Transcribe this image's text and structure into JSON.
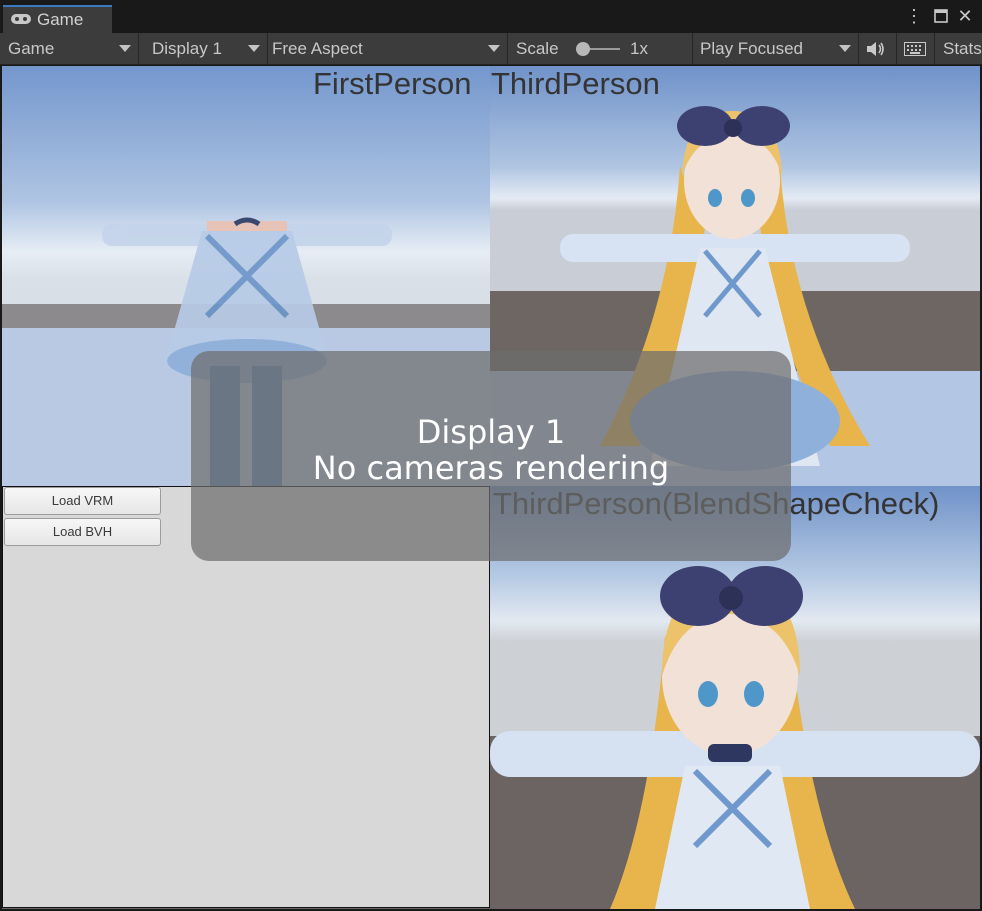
{
  "tab": {
    "title": "Game",
    "icon": "gamepad-icon"
  },
  "window_buttons": {
    "menu_icon": "kebab-menu-icon",
    "maximize_icon": "maximize-icon",
    "close_icon": "close-icon",
    "menu_glyph": "⋮",
    "close_glyph": "✕"
  },
  "toolbar": {
    "view_mode": "Game",
    "display": "Display 1",
    "aspect": "Free Aspect",
    "scale_label": "Scale",
    "scale_value": "1x",
    "play_mode": "Play Focused",
    "audio_icon": "speaker-icon",
    "keyboard_icon": "keyboard-icon",
    "stats": "Stats"
  },
  "viewport": {
    "label_first_person": "FirstPerson",
    "label_third_person": "ThirdPerson",
    "label_blendshape": "ThirdPerson(BlendShapeCheck)",
    "overlay_line1": "Display 1",
    "overlay_line2": "No cameras rendering",
    "gui_buttons": [
      "Load VRM",
      "Load BVH"
    ],
    "colors": {
      "sky_top": "#7294cb",
      "sky_horizon": "#e4ebf4",
      "ground": "#6b6563",
      "hair": "#e8b64d",
      "dress": "#9fb9dc",
      "bow": "#3c4070"
    }
  }
}
